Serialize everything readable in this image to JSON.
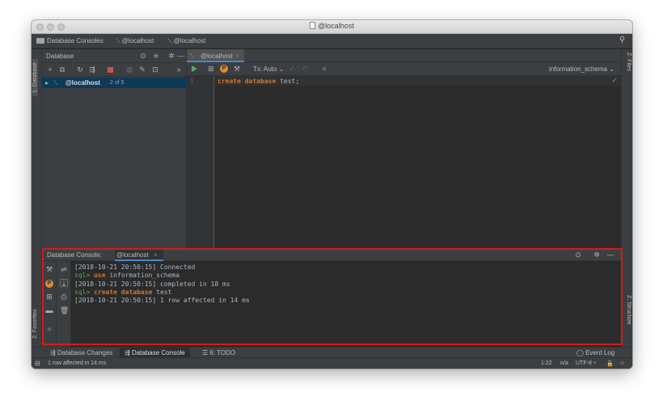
{
  "window": {
    "title": "@localhost"
  },
  "navbar": {
    "items": [
      "Database Consoles",
      "@localhost",
      "@localhost"
    ]
  },
  "left_strip": {
    "database_tab": "1: Database",
    "favorites_tab": "2: Favorites"
  },
  "right_strip": {
    "files_tab": "Z: Files",
    "structure_tab": "Z: Structure"
  },
  "database_panel": {
    "title": "Database",
    "tree": {
      "name": "@localhost",
      "count": "2 of 5"
    }
  },
  "editor": {
    "tab_label": "@localhost",
    "tx_mode": "Tx: Auto",
    "schema": "information_schema",
    "line_number": "1",
    "code": {
      "kw1": "create",
      "kw2": "database",
      "rest": " test;"
    }
  },
  "console": {
    "title": "Database Console:",
    "tab_label": "@localhost",
    "log": [
      {
        "ts": "[2018-10-21 20:50:15]",
        "text": " Connected"
      },
      {
        "prompt": "sql>",
        "kw": "use",
        "rest": " information_schema"
      },
      {
        "ts": "[2018-10-21 20:50:15]",
        "text": " completed in 18 ms"
      },
      {
        "prompt": "sql>",
        "kw": "create database",
        "rest": " test"
      },
      {
        "ts": "[2018-10-21 20:50:15]",
        "text": " 1 row affected in 14 ms"
      }
    ]
  },
  "bottom_tabs": {
    "changes": "Database Changes",
    "console": "Database Console",
    "todo": "6: TODO",
    "event_log": "Event Log"
  },
  "status": {
    "message": "1 row affected in 14 ms",
    "position": "1:22",
    "na": "n/a",
    "encoding": "UTF-8 ÷"
  },
  "colors": {
    "highlight_box": "#d61b1b",
    "keyword": "#cc7832",
    "prompt": "#62a35a",
    "selection": "#0d3a58"
  }
}
